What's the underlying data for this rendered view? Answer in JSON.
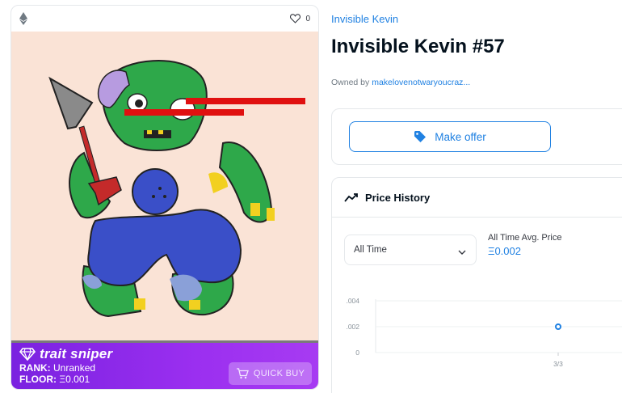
{
  "card": {
    "favorites_count": "0",
    "trait_sniper": {
      "brand": "trait sniper",
      "rank_label": "RANK:",
      "rank_value": "Unranked",
      "floor_label": "FLOOR:",
      "floor_value": "Ξ0.001",
      "quick_buy_label": "QUICK BUY"
    }
  },
  "item": {
    "collection": "Invisible Kevin",
    "title": "Invisible Kevin #57",
    "owned_by_label": "Owned by",
    "owner": "makelovenotwaryoucraz..."
  },
  "offer": {
    "button_label": "Make offer"
  },
  "price_history": {
    "heading": "Price History",
    "range_selected": "All Time",
    "avg_label": "All Time Avg. Price",
    "avg_value": "Ξ0.002"
  },
  "chart_data": {
    "type": "scatter",
    "y_ticks": [
      ".004",
      ".002",
      "0"
    ],
    "ylim": [
      0,
      0.004
    ],
    "x_ticks": [
      "3/3"
    ],
    "points": [
      {
        "x": "3/3",
        "y": 0.002
      }
    ],
    "point_color": "#2081e2"
  },
  "colors": {
    "accent": "#2081e2",
    "sniper_purple": "#8a28e8"
  }
}
